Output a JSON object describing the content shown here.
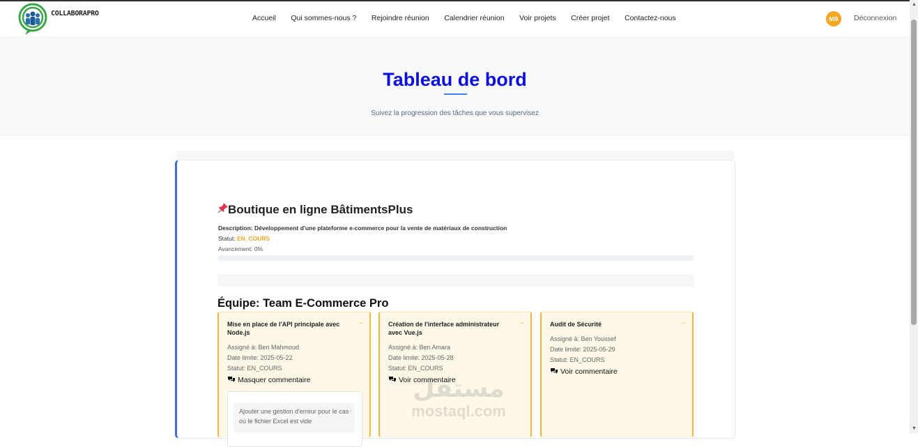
{
  "brand": {
    "name": "COLLABORAPRO"
  },
  "nav": {
    "links": [
      "Accueil",
      "Qui sommes-nous ?",
      "Rejoindre réunion",
      "Calendrier réunion",
      "Voir projets",
      "Créer projet",
      "Contactez-nous"
    ],
    "avatar_initials": "MB",
    "logout_label": "Déconnexion"
  },
  "hero": {
    "title": "Tableau de bord",
    "subtitle": "Suivez la progression des tâches que vous supervisez"
  },
  "project": {
    "title": "Boutique en ligne BâtimentsPlus",
    "description": "Description: Développement d'une plateforme e-commerce pour la vente de matériaux de construction",
    "status_label": "Statut: ",
    "status_value": "EN_COURS",
    "progress_label": "Avancement: 0%",
    "progress_fraction": 0,
    "team_label": "Équipe: Team E-Commerce Pro"
  },
  "tasks": [
    {
      "title": "Mise en place de l'API principale avec Node.js",
      "assignee": "Assigné à: Ben Mahmoud",
      "deadline": "Date limite: 2025-05-22",
      "status": "Statut: EN_COURS",
      "comment_toggle": "Masquer commentaire",
      "comment": "Ajouter une gestion d'erreur pour le cas où le fichier Excel est vide"
    },
    {
      "title": "Création de l'interface administrateur avec Vue.js",
      "assignee": "Assigné à: Ben Amara",
      "deadline": "Date limite: 2025-05-28",
      "status": "Statut: EN_COURS",
      "comment_toggle": "Voir commentaire"
    },
    {
      "title": "Audit de Sécurité",
      "assignee": "Assigné à: Ben Youssef",
      "deadline": "Date limite: 2025-05-29",
      "status": "Statut: EN_COURS",
      "comment_toggle": "Voir commentaire"
    }
  ],
  "watermark": {
    "arabic": "مستقل",
    "latin": "mostaql.com"
  },
  "colors": {
    "accent": "#0b0ee0",
    "status": "#f5a623",
    "task_border": "#f1b63c",
    "project_border": "#3b6fe0"
  }
}
